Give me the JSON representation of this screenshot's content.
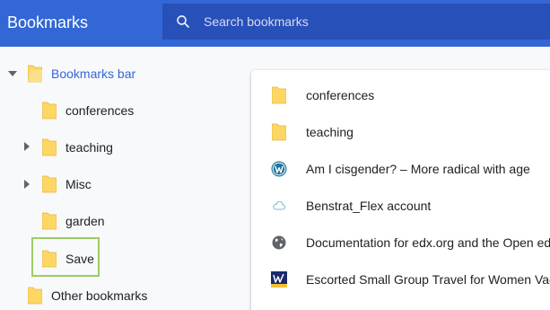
{
  "app": {
    "title": "Bookmarks"
  },
  "search": {
    "placeholder": "Search bookmarks"
  },
  "colors": {
    "header": "#3367d6",
    "search_bg": "#2850b9",
    "folder": "#fdd663",
    "selected_text": "#3367d6",
    "highlight_border": "#9ccc65"
  },
  "sidebar": {
    "root": {
      "label": "Bookmarks bar",
      "icon": "folder-open-icon",
      "expanded": true
    },
    "children": [
      {
        "label": "conferences",
        "icon": "folder-icon",
        "has_children": false
      },
      {
        "label": "teaching",
        "icon": "folder-icon",
        "has_children": true
      },
      {
        "label": "Misc",
        "icon": "folder-icon",
        "has_children": true
      },
      {
        "label": "garden",
        "icon": "folder-icon",
        "has_children": false
      },
      {
        "label": "Save",
        "icon": "folder-icon",
        "has_children": false
      }
    ],
    "other": {
      "label": "Other bookmarks",
      "icon": "folder-icon"
    }
  },
  "list": {
    "items": [
      {
        "label": "conferences",
        "icon": "folder-icon"
      },
      {
        "label": "teaching",
        "icon": "folder-icon"
      },
      {
        "label": "Am I cisgender? – More radical with age",
        "icon": "wordpress-icon"
      },
      {
        "label": "Benstrat_Flex account",
        "icon": "cloud-icon"
      },
      {
        "label": "Documentation for edx.org and the Open edX",
        "icon": "globe-icon"
      },
      {
        "label": "Escorted Small Group Travel for Women Vacat",
        "icon": "site-logo-icon"
      }
    ]
  }
}
